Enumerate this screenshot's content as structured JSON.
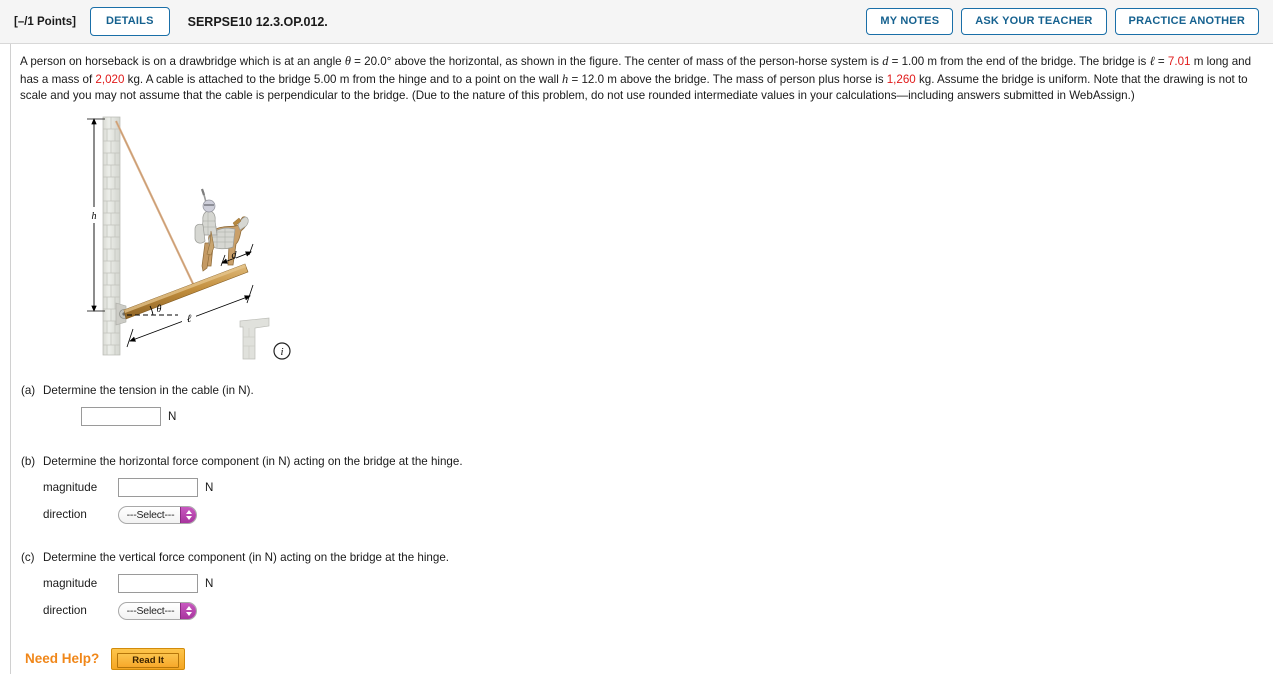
{
  "header": {
    "points": "[–/1 Points]",
    "details_label": "DETAILS",
    "question_id": "SERPSE10 12.3.OP.012.",
    "my_notes_label": "MY NOTES",
    "ask_teacher_label": "ASK YOUR TEACHER",
    "practice_another_label": "PRACTICE ANOTHER",
    "accent_color": "#15618f"
  },
  "question": {
    "s1": "A person on horseback is on a drawbridge which is at an angle ",
    "theta_sym": "θ",
    "s2": " = 20.0° above the horizontal, as shown in the figure. The center of mass of the person-horse system is ",
    "d_sym": "d",
    "s3": " = 1.00 m from the end of the bridge. The bridge is ",
    "ell_sym": "ℓ",
    "s4": " = ",
    "ell_value": "7.01",
    "s5": " m long and has a mass of ",
    "mass_bridge": "2,020",
    "s6": " kg. A cable is attached to the bridge 5.00 m from the hinge and to a point on the wall ",
    "h_sym": "h",
    "s7": " = 12.0 m above the bridge. The mass of person plus horse is ",
    "mass_person_horse": "1,260",
    "s8": " kg. Assume the bridge is uniform. Note that the drawing is not to scale and you may not assume that the cable is perpendicular to the bridge. (Due to the nature of this problem, do not use rounded intermediate values in your calculations—including answers submitted in WebAssign.)"
  },
  "figure": {
    "label_h": "h",
    "label_theta": "θ",
    "label_ell": "ℓ",
    "label_d": "d",
    "info_icon": "i",
    "wall_color": "#e3e4df",
    "bridge_color": "#c9913f",
    "cable_color": "#d8b08c"
  },
  "parts": [
    {
      "label": "(a)",
      "question": "Determine the tension in the cable (in N).",
      "rows": [
        {
          "type": "input",
          "label": "",
          "value": "",
          "unit": "N"
        }
      ]
    },
    {
      "label": "(b)",
      "question": "Determine the horizontal force component (in N) acting on the bridge at the hinge.",
      "rows": [
        {
          "type": "input",
          "label": "magnitude",
          "value": "",
          "unit": "N"
        },
        {
          "type": "select",
          "label": "direction",
          "value": "---Select---"
        }
      ]
    },
    {
      "label": "(c)",
      "question": "Determine the vertical force component (in N) acting on the bridge at the hinge.",
      "rows": [
        {
          "type": "input",
          "label": "magnitude",
          "value": "",
          "unit": "N"
        },
        {
          "type": "select",
          "label": "direction",
          "value": "---Select---"
        }
      ]
    }
  ],
  "need_help": {
    "label": "Need Help?",
    "read_it_label": "Read It",
    "color": "#f0871a"
  }
}
